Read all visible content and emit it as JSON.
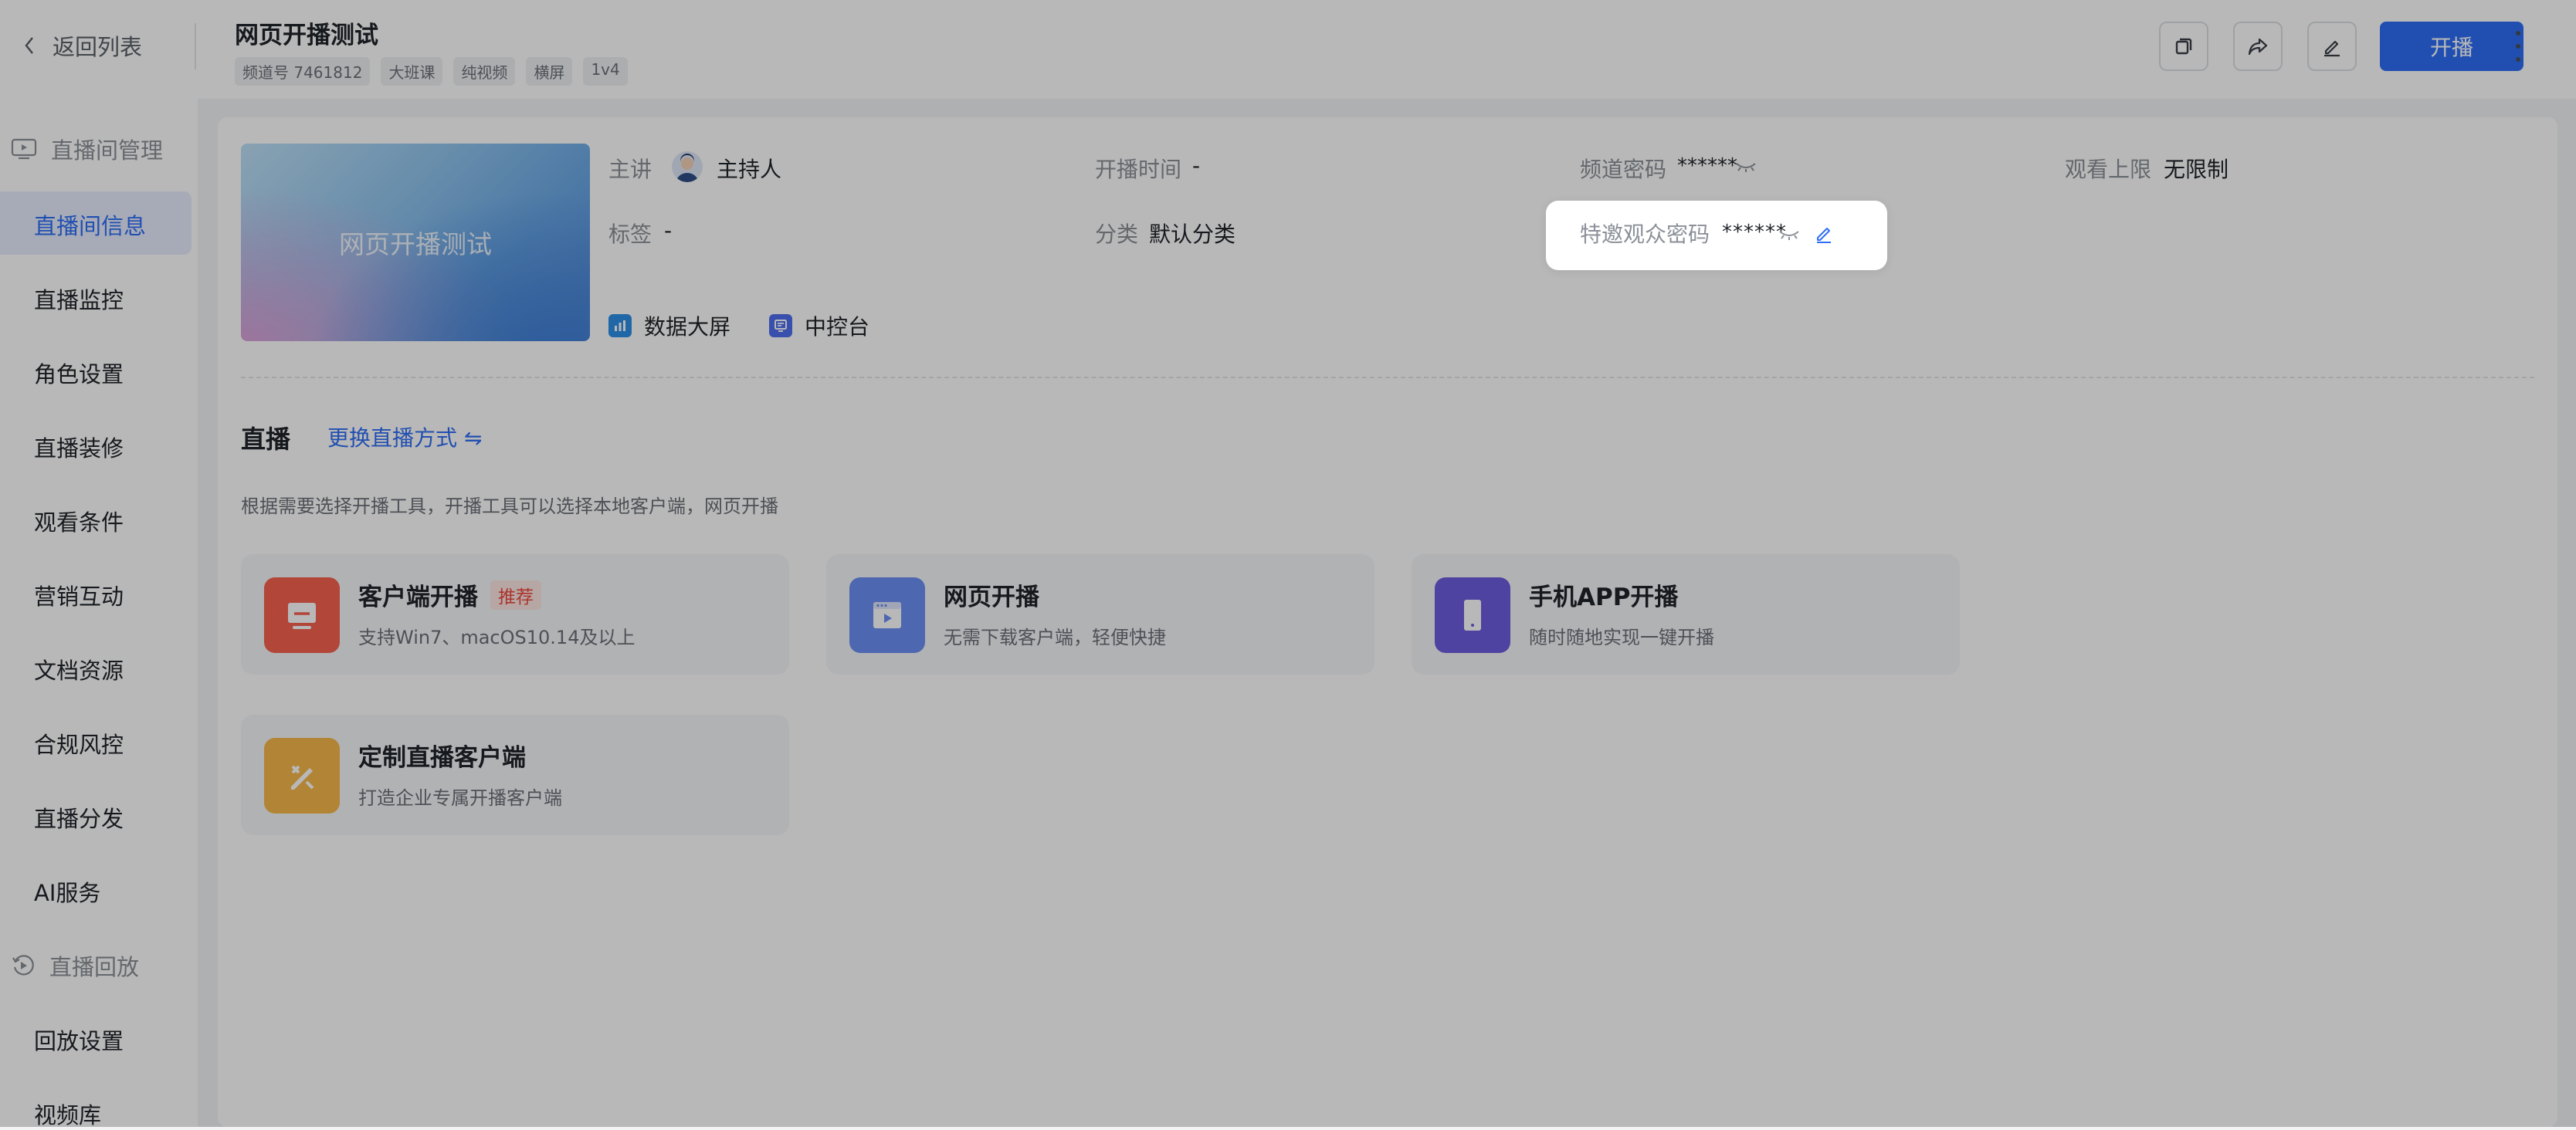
{
  "header": {
    "back_label": "返回列表",
    "title": "网页开播测试",
    "tags": [
      "频道号 7461812",
      "大班课",
      "纯视频",
      "横屏",
      "1v4"
    ],
    "start_button": "开播",
    "icons": [
      "copy-icon",
      "share-icon",
      "edit-icon",
      "more-icon"
    ]
  },
  "sidebar": {
    "group1": "直播间管理",
    "items": [
      "直播间信息",
      "直播监控",
      "角色设置",
      "直播装修",
      "观看条件",
      "营销互动",
      "文档资源",
      "合规风控",
      "直播分发",
      "AI服务"
    ],
    "group2": "直播回放",
    "items2": [
      "回放设置",
      "视频库"
    ],
    "active": "直播间信息"
  },
  "info": {
    "cover_text": "网页开播测试",
    "host_label": "主讲",
    "host_value": "主持人",
    "start_time_label": "开播时间",
    "start_time_value": "-",
    "channel_pwd_label": "频道密码",
    "channel_pwd_value": "******",
    "viewer_limit_label": "观看上限",
    "viewer_limit_value": "无限制",
    "tag_label": "标签",
    "tag_value": "-",
    "category_label": "分类",
    "category_value": "默认分类",
    "guest_pwd_label": "特邀观众密码",
    "guest_pwd_value": "******",
    "links": [
      "数据大屏",
      "中控台"
    ]
  },
  "live": {
    "title": "直播",
    "switch_link": "更换直播方式 ⇋",
    "hint": "根据需要选择开播工具，开播工具可以选择本地客户端，网页开播",
    "tools": [
      {
        "name": "客户端开播",
        "badge": "推荐",
        "desc": "支持Win7、macOS10.14及以上",
        "color": "#f5614f"
      },
      {
        "name": "网页开播",
        "desc": "无需下载客户端，轻便快捷",
        "color": "#6c8ff5"
      },
      {
        "name": "手机APP开播",
        "desc": "随时随地实现一键开播",
        "color": "#6e5de0"
      },
      {
        "name": "定制直播客户端",
        "desc": "打造企业专属开播客户端",
        "color": "#f7b84a"
      }
    ]
  }
}
